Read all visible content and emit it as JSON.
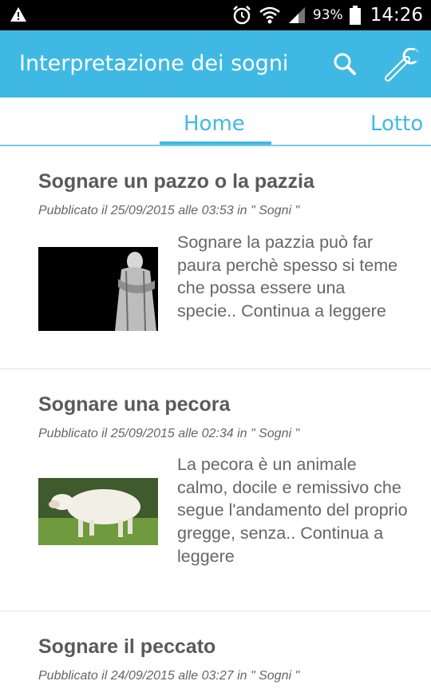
{
  "status_bar": {
    "warning_icon": "warning-icon",
    "alarm_icon": "alarm-icon",
    "wifi_icon": "wifi-icon",
    "signal_icon": "signal-icon",
    "battery_pct": "93%",
    "battery_level": 0.93,
    "time": "14:26"
  },
  "app_bar": {
    "title": "Interpretazione dei sogni",
    "search_icon": "search-icon",
    "settings_icon": "wrench-icon",
    "color": "#3fb9e3"
  },
  "tabs": [
    {
      "label": "Home",
      "selected": true
    },
    {
      "label": "Lotto",
      "selected": false
    }
  ],
  "posts": [
    {
      "title": "Sognare un pazzo o la pazzia",
      "meta": "Pubblicato il 25/09/2015 alle 03:53 in \" Sogni \"",
      "excerpt": "Sognare la pazzia può far paura perchè spesso si teme che possa essere una specie..",
      "continua": "Continua a leggere"
    },
    {
      "title": "Sognare una pecora",
      "meta": "Pubblicato il 25/09/2015 alle 02:34 in \" Sogni \"",
      "excerpt": "La pecora è un animale calmo, docile e remissivo che segue l'andamento del proprio gregge, senza..",
      "continua": "Continua a leggere"
    },
    {
      "title": "Sognare il peccato",
      "meta": "Pubblicato il 24/09/2015 alle 03:27 in \" Sogni \""
    }
  ]
}
